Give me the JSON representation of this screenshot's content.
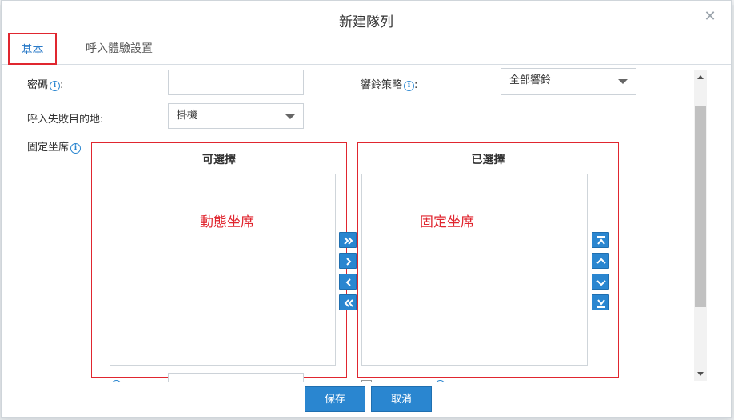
{
  "dialog": {
    "title": "新建隊列",
    "close_glyph": "✕"
  },
  "tabs": [
    {
      "label": "基本",
      "active": true
    },
    {
      "label": "呼入體驗設置",
      "active": false
    }
  ],
  "form": {
    "password_label": "密碼",
    "password_value": "",
    "ring_strategy_label": "響鈴策略",
    "ring_strategy_value": "全部響鈴",
    "fail_dest_label": "呼入失敗目的地:",
    "fail_dest_value": "掛機",
    "fixed_agents_label": "固定坐席",
    "colon": ":"
  },
  "selector": {
    "available_title": "可選擇",
    "selected_title": "已選擇",
    "available_annotation": "動態坐席",
    "selected_annotation": "固定坐席"
  },
  "footer": {
    "save_label": "保存",
    "cancel_label": "取消"
  },
  "colors": {
    "accent": "#2a86d0",
    "highlight_red": "#e0262f"
  },
  "icons": {
    "info": "i",
    "move_all_right": "double-chevron-right",
    "move_right": "chevron-right",
    "move_left": "chevron-left",
    "move_all_left": "double-chevron-left",
    "move_top": "arrow-to-top",
    "move_up": "chevron-up",
    "move_down": "chevron-down",
    "move_bottom": "arrow-to-bottom"
  }
}
